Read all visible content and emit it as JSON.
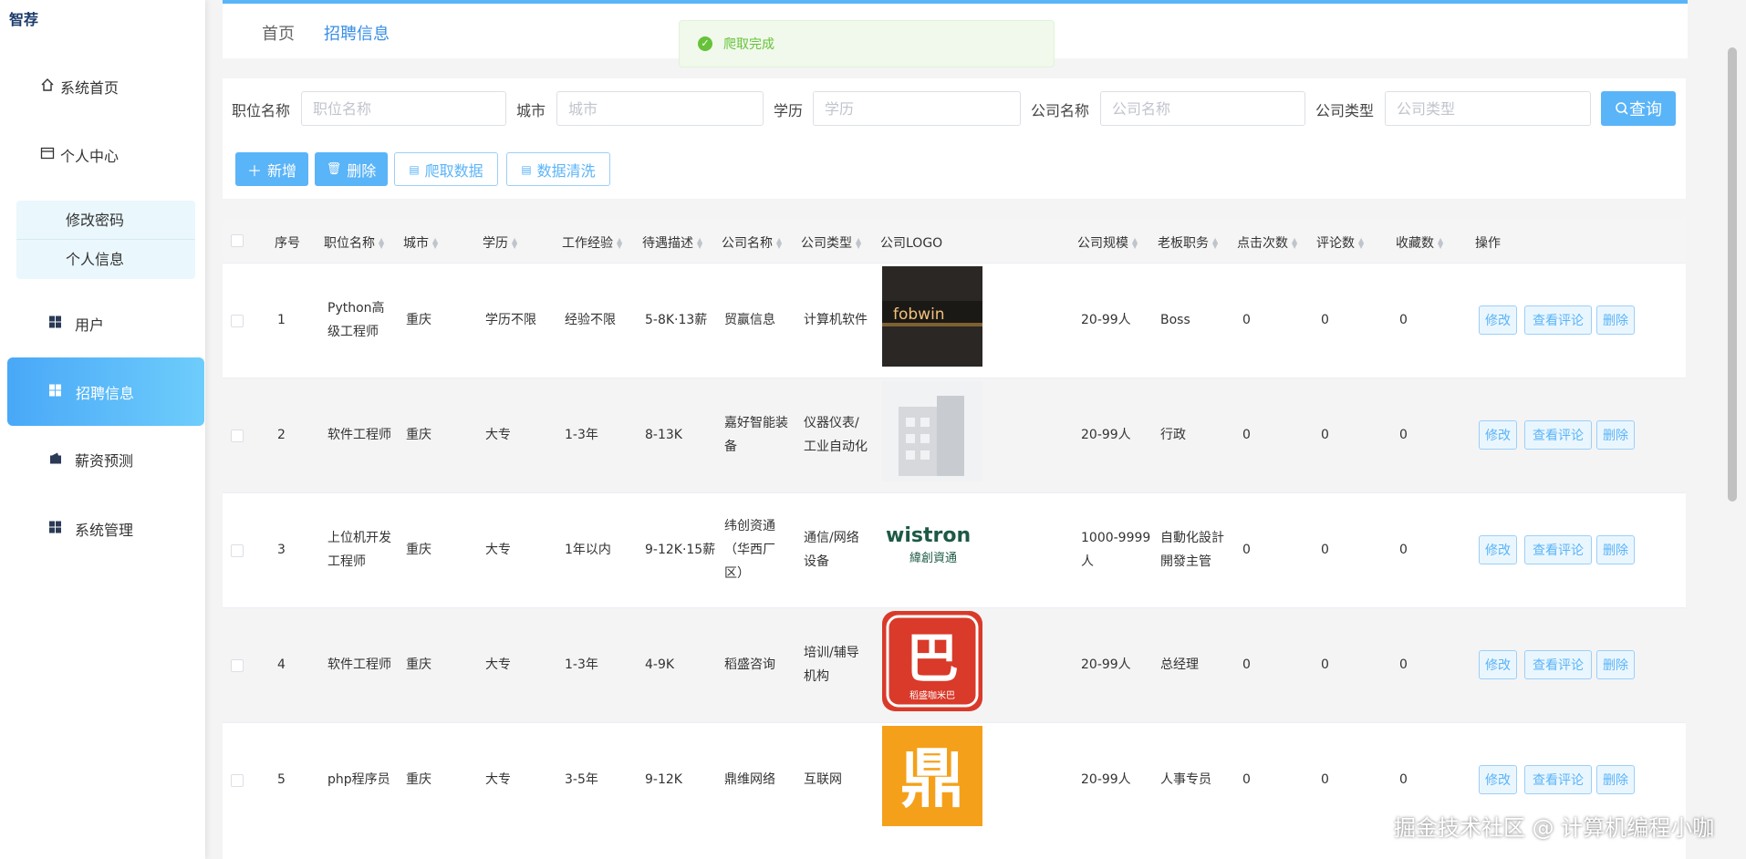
{
  "app": {
    "logo": "智荐"
  },
  "sidebar": {
    "home": "系统首页",
    "personal": "个人中心",
    "sub": [
      "修改密码",
      "个人信息"
    ],
    "user": "用户",
    "recruit": "招聘信息",
    "salary": "薪资预测",
    "system": "系统管理"
  },
  "breadcrumb": {
    "home": "首页",
    "current": "招聘信息"
  },
  "toast": "爬取完成",
  "search": {
    "fields": [
      {
        "label": "职位名称",
        "placeholder": "职位名称"
      },
      {
        "label": "城市",
        "placeholder": "城市"
      },
      {
        "label": "学历",
        "placeholder": "学历"
      },
      {
        "label": "公司名称",
        "placeholder": "公司名称"
      },
      {
        "label": "公司类型",
        "placeholder": "公司类型"
      }
    ],
    "query": "查询"
  },
  "toolbar": {
    "add": "新增",
    "delete": "删除",
    "crawl": "爬取数据",
    "clean": "数据清洗"
  },
  "table": {
    "headers": [
      "序号",
      "职位名称",
      "城市",
      "学历",
      "工作经验",
      "待遇描述",
      "公司名称",
      "公司类型",
      "公司LOGO",
      "公司规模",
      "老板职务",
      "点击次数",
      "评论数",
      "收藏数",
      "操作"
    ],
    "actions": {
      "edit": "修改",
      "view": "查看评论",
      "delete": "删除"
    },
    "rows": [
      {
        "no": "1",
        "title": [
          "Python高",
          "级工程师"
        ],
        "city": "重庆",
        "edu": "学历不限",
        "exp": "经验不限",
        "pay": "5-8K·13薪",
        "company": [
          "贸赢信息"
        ],
        "type": [
          "计算机软件"
        ],
        "logo": "fobwin",
        "size": [
          "20-99人"
        ],
        "boss": [
          "Boss"
        ],
        "clicks": "0",
        "comments": "0",
        "favs": "0"
      },
      {
        "no": "2",
        "title": [
          "软件工程师"
        ],
        "city": "重庆",
        "edu": "大专",
        "exp": "1-3年",
        "pay": "8-13K",
        "company": [
          "嘉好智能装",
          "备"
        ],
        "type": [
          "仪器仪表/",
          "工业自动化"
        ],
        "logo": "building",
        "size": [
          "20-99人"
        ],
        "boss": [
          "行政"
        ],
        "clicks": "0",
        "comments": "0",
        "favs": "0"
      },
      {
        "no": "3",
        "title": [
          "上位机开发",
          "工程师"
        ],
        "city": "重庆",
        "edu": "大专",
        "exp": "1年以内",
        "pay": "9-12K·15薪",
        "company": [
          "纬创资通",
          "（华西厂",
          "区）"
        ],
        "type": [
          "通信/网络",
          "设备"
        ],
        "logo": "wistron",
        "size": [
          "1000-9999",
          "人"
        ],
        "boss": [
          "自動化設計",
          "開發主管"
        ],
        "clicks": "0",
        "comments": "0",
        "favs": "0"
      },
      {
        "no": "4",
        "title": [
          "软件工程师"
        ],
        "city": "重庆",
        "edu": "大专",
        "exp": "1-3年",
        "pay": "4-9K",
        "company": [
          "稻盛咨询"
        ],
        "type": [
          "培训/辅导",
          "机构"
        ],
        "logo": "ba",
        "size": [
          "20-99人"
        ],
        "boss": [
          "总经理"
        ],
        "clicks": "0",
        "comments": "0",
        "favs": "0"
      },
      {
        "no": "5",
        "title": [
          "php程序员"
        ],
        "city": "重庆",
        "edu": "大专",
        "exp": "3-5年",
        "pay": "9-12K",
        "company": [
          "鼎维网络"
        ],
        "type": [
          "互联网"
        ],
        "logo": "ding",
        "size": [
          "20-99人"
        ],
        "boss": [
          "人事专员"
        ],
        "clicks": "0",
        "comments": "0",
        "favs": "0"
      }
    ]
  },
  "logos": {
    "fobwin": "fobwin",
    "wistron": "wistron",
    "wistron_cn": "緯創資通",
    "ba": "巴",
    "ba_sub": "稻盛咖米巴",
    "ding": "鼎"
  },
  "watermark": "掘金技术社区 @ 计算机编程小咖",
  "colors": {
    "accent": "#5ab4f8",
    "success": "#67c23a"
  }
}
